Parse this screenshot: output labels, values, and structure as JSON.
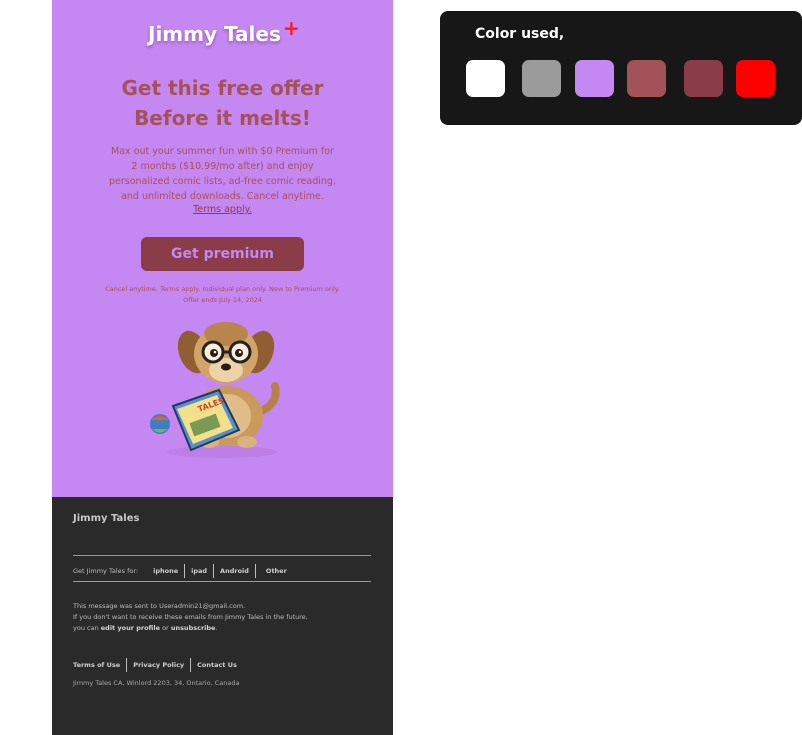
{
  "email": {
    "brand": "Jimmy Tales",
    "brand_plus": "+",
    "headline_line1": "Get this free offer",
    "headline_line2": "Before it melts!",
    "body_lines": [
      "Max out your summer fun with $0 Premium for",
      "2 months ($10.99/mo after) and enjoy",
      "personalized comic lists, ad-free comic reading,",
      "and unlimited downloads. Cancel anytime."
    ],
    "terms_link": "Terms apply.",
    "cta_label": "Get premium",
    "fineprint_lines": [
      "Cancel anytime. Terms apply. Individual plan only. New to Premium only.",
      "Offer ends July 14, 2024"
    ],
    "dog_book_text": "TALES"
  },
  "footer": {
    "brand": "Jimmy Tales",
    "get_label": "Get Jimmy Tales for:",
    "platforms": [
      "iphone",
      "ipad",
      "Android",
      "Other"
    ],
    "message_line1": "This message was sent to Useradmin21@gmail.com.",
    "message_line2": "If you don't want to receive these emails from Jimmy Tales in the future,",
    "message_line3_prefix": "you can ",
    "edit_profile": "edit your profile",
    "or_text": " or ",
    "unsubscribe": "unsubscribe",
    "period": ".",
    "links": [
      "Terms of Use",
      "Privacy Policy",
      "Contact Us"
    ],
    "address": "Jimmy Tales CA, Winlord 2203, 34,  Ontario,  Canada"
  },
  "palette": {
    "title": "Color used,",
    "colors": [
      "#ffffff",
      "#9b9b9b",
      "#c587f1",
      "#a4525a",
      "#8a3c49",
      "#ff0000"
    ]
  },
  "icons": [
    "plus-icon",
    "dog-reading-illustration"
  ]
}
